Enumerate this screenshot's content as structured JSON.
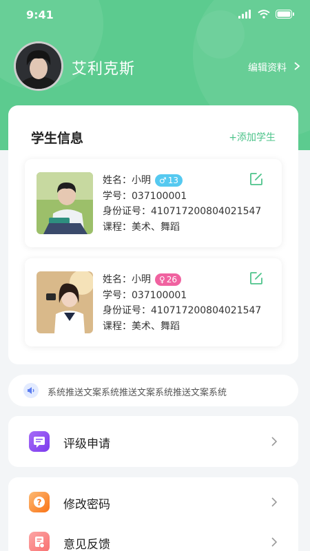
{
  "status": {
    "time": "9:41"
  },
  "profile": {
    "name": "艾利克斯",
    "edit_label": "编辑资料"
  },
  "students_section": {
    "title": "学生信息",
    "add_label": "+添加学生",
    "students": [
      {
        "name_label": "姓名：",
        "name": "小明",
        "gender": "male",
        "gender_symbol": "♂",
        "age": "13",
        "id_label": "学号：",
        "student_no": "037100001",
        "idcard_label": "身份证号：",
        "idcard": "410717200804021547",
        "course_label": "课程：",
        "courses": "美术、舞蹈"
      },
      {
        "name_label": "姓名：",
        "name": "小明",
        "gender": "female",
        "gender_symbol": "♀",
        "age": "26",
        "id_label": "学号：",
        "student_no": "037100001",
        "idcard_label": "身份证号：",
        "idcard": "410717200804021547",
        "course_label": "课程：",
        "courses": "美术、舞蹈"
      }
    ]
  },
  "notice": {
    "text": "系统推送文案系统推送文案系统推送文案系统"
  },
  "menu": {
    "rating": {
      "label": "评级申请",
      "icon": "chat-icon",
      "color": "#8b5cf6"
    },
    "password": {
      "label": "修改密码",
      "icon": "question-icon",
      "color": "#fb923c"
    },
    "feedback": {
      "label": "意见反馈",
      "icon": "feedback-icon",
      "color": "#f87171"
    }
  },
  "colors": {
    "brand": "#5ccb8f",
    "accent_text": "#4cc38a",
    "male": "#55c9f0",
    "female": "#f062a0"
  }
}
